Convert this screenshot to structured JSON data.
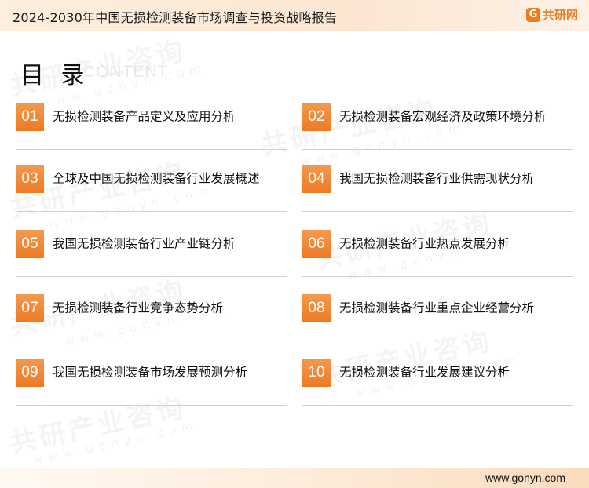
{
  "header": {
    "title": "2024-2030年中国无损检测装备市场调查与投资战略报告",
    "brand_mark": "G",
    "brand_name": "共研网"
  },
  "toc": {
    "heading": "目 录",
    "subheading": "CONTENT"
  },
  "watermark": {
    "text": "共研产业咨询",
    "url": "www.gonyn.com"
  },
  "items": [
    {
      "num": "01",
      "text": "无损检测装备产品定义及应用分析"
    },
    {
      "num": "02",
      "text": "无损检测装备宏观经济及政策环境分析"
    },
    {
      "num": "03",
      "text": "全球及中国无损检测装备行业发展概述"
    },
    {
      "num": "04",
      "text": "我国无损检测装备行业供需现状分析"
    },
    {
      "num": "05",
      "text": "我国无损检测装备行业产业链分析"
    },
    {
      "num": "06",
      "text": "无损检测装备行业热点发展分析"
    },
    {
      "num": "07",
      "text": "无损检测装备行业竞争态势分析"
    },
    {
      "num": "08",
      "text": "无损检测装备行业重点企业经营分析"
    },
    {
      "num": "09",
      "text": "我国无损检测装备市场发展预测分析"
    },
    {
      "num": "10",
      "text": "无损检测装备行业发展建议分析"
    }
  ],
  "footer": {
    "url": "www.gonyn.com"
  },
  "colors": {
    "accent": "#ee7a24",
    "header_bg": "#fbe6d2"
  }
}
